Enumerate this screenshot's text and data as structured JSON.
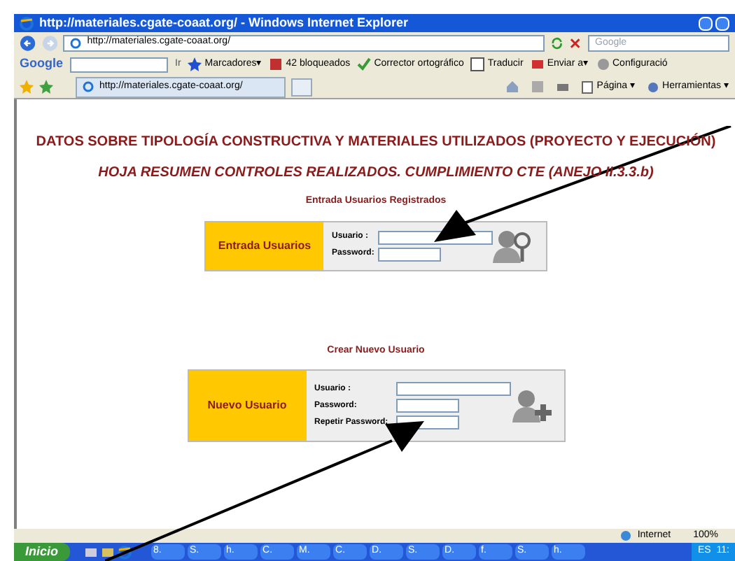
{
  "window": {
    "title": "http://materiales.cgate-coaat.org/ - Windows Internet Explorer"
  },
  "address_bar": {
    "url": "http://materiales.cgate-coaat.org/",
    "search_placeholder": "Google"
  },
  "google_toolbar": {
    "logo": "Google",
    "go": "Ir",
    "items": [
      {
        "kind": "star",
        "label": "Marcadores▾"
      },
      {
        "kind": "block",
        "label": "42 bloqueados"
      },
      {
        "kind": "spell",
        "label": "Corrector ortográfico"
      },
      {
        "kind": "translate",
        "label": "Traducir"
      },
      {
        "kind": "send",
        "label": "Enviar a▾"
      },
      {
        "kind": "gear",
        "label": "Configuració"
      }
    ]
  },
  "tab": {
    "title": "http://materiales.cgate-coaat.org/"
  },
  "command_bar": [
    "Página ▾",
    "Herramientas ▾"
  ],
  "page": {
    "heading": "DATOS SOBRE TIPOLOGÍA CONSTRUCTIVA Y MATERIALES UTILIZADOS (PROYECTO Y EJECUCIÓN)",
    "subheading": "HOJA RESUMEN CONTROLES REALIZADOS. CUMPLIMIENTO CTE (ANEJO II.3.3.b)",
    "forms": [
      {
        "kind": "login",
        "section_title": "Entrada Usuarios Registrados",
        "panel_label": "Entrada Usuarios",
        "fields": [
          {
            "label": "Usuario :",
            "wide": true
          },
          {
            "label": "Password:",
            "wide": false
          }
        ]
      },
      {
        "kind": "signup",
        "section_title": "Crear Nuevo Usuario",
        "panel_label": "Nuevo Usuario",
        "fields": [
          {
            "label": "Usuario :",
            "wide": true
          },
          {
            "label": "Password:",
            "wide": false
          },
          {
            "label": "Repetir Password:",
            "wide": false
          }
        ]
      }
    ]
  },
  "status_bar": {
    "zone": "Internet",
    "zoom": "100%"
  },
  "taskbar": {
    "start": "Inicio",
    "buttons": [
      "8.",
      "S.",
      "h.",
      "C.",
      "M.",
      "C.",
      "D.",
      "S.",
      "D.",
      "f.",
      "S.",
      "h."
    ],
    "language": "ES",
    "clock": "11:"
  }
}
